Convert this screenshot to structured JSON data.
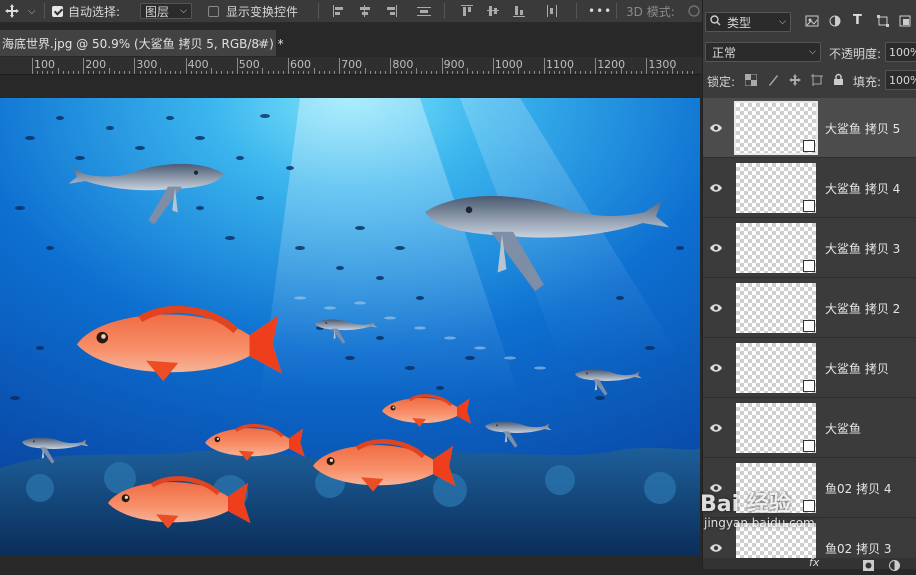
{
  "options_bar": {
    "auto_select_label": "自动选择:",
    "auto_select_checked": true,
    "select_target": "图层",
    "show_transform_label": "显示变换控件",
    "show_transform_checked": false,
    "more_label": "•••",
    "mode_3d_label": "3D 模式:"
  },
  "document_tab": {
    "title": "海底世界.jpg @ 50.9% (大鲨鱼 拷贝 5, RGB/8#) *",
    "close": "×"
  },
  "ruler": {
    "ticks": [
      "100",
      "200",
      "300",
      "400",
      "500",
      "600",
      "700",
      "800",
      "900",
      "1000",
      "1100",
      "1200",
      "1300"
    ]
  },
  "layers_panel": {
    "filter_kind": "类型",
    "blend_mode": "正常",
    "opacity_label": "不透明度:",
    "opacity_value": "100%",
    "lock_label": "锁定:",
    "fill_label": "填充:",
    "fill_value": "100%",
    "layers": [
      {
        "name": "大鲨鱼 拷贝 5",
        "active": true
      },
      {
        "name": "大鲨鱼 拷贝 4",
        "active": false
      },
      {
        "name": "大鲨鱼 拷贝 3",
        "active": false
      },
      {
        "name": "大鲨鱼 拷贝 2",
        "active": false
      },
      {
        "name": "大鲨鱼 拷贝",
        "active": false
      },
      {
        "name": "大鲨鱼",
        "active": false
      },
      {
        "name": "鱼02 拷贝 4",
        "active": false
      },
      {
        "name": "鱼02 拷贝 3",
        "active": false
      }
    ],
    "footer_fx": "fx"
  },
  "watermark": {
    "logo": "Bai 经验",
    "url": "jingyan.baidu.com"
  },
  "colors": {
    "water_light": "#5fd4f5",
    "water_deep": "#0a3d94",
    "fish_red": "#f0603a",
    "whale": "#aab6c8"
  }
}
